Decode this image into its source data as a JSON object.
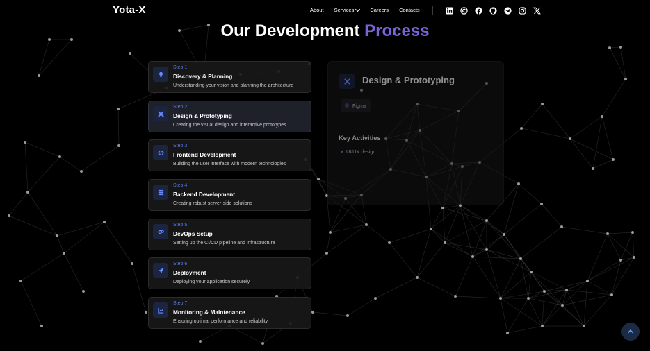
{
  "brand": {
    "logo": "Yota-X"
  },
  "nav": {
    "about": "About",
    "services": "Services",
    "careers": "Careers",
    "contacts": "Contacts"
  },
  "socials": [
    "linkedin-icon",
    "crunchbase-icon",
    "facebook-icon",
    "github-icon",
    "telegram-icon",
    "instagram-icon",
    "x-icon"
  ],
  "hero": {
    "title_main": "Our Development",
    "title_accent": "Process"
  },
  "steps": [
    {
      "num": "Step 1",
      "title": "Discovery & Planning",
      "desc": "Understanding your vision and planning the architecture",
      "icon": "lightbulb-icon"
    },
    {
      "num": "Step 2",
      "title": "Design & Prototyping",
      "desc": "Creating the visual design and interactive prototypes",
      "icon": "design-tools-icon"
    },
    {
      "num": "Step 3",
      "title": "Frontend Development",
      "desc": "Building the user interface with modern technologies",
      "icon": "code-icon"
    },
    {
      "num": "Step 4",
      "title": "Backend Development",
      "desc": "Creating robust server-side solutions",
      "icon": "server-icon"
    },
    {
      "num": "Step 5",
      "title": "DevOps Setup",
      "desc": "Setting up the CI/CD pipeline and infrastructure",
      "icon": "gears-icon"
    },
    {
      "num": "Step 6",
      "title": "Deployment",
      "desc": "Deploying your application securely",
      "icon": "rocket-icon"
    },
    {
      "num": "Step 7",
      "title": "Monitoring & Maintenance",
      "desc": "Ensuring optimal performance and reliability",
      "icon": "chart-line-icon"
    }
  ],
  "detail": {
    "title": "Design & Prototyping",
    "tool": "Figma",
    "key_title": "Key Activities",
    "activity": "UI/UX design"
  },
  "colors": {
    "accent": "#7b63d8",
    "step_number": "#5b7cf2",
    "icon_bg": "#1c2540"
  }
}
